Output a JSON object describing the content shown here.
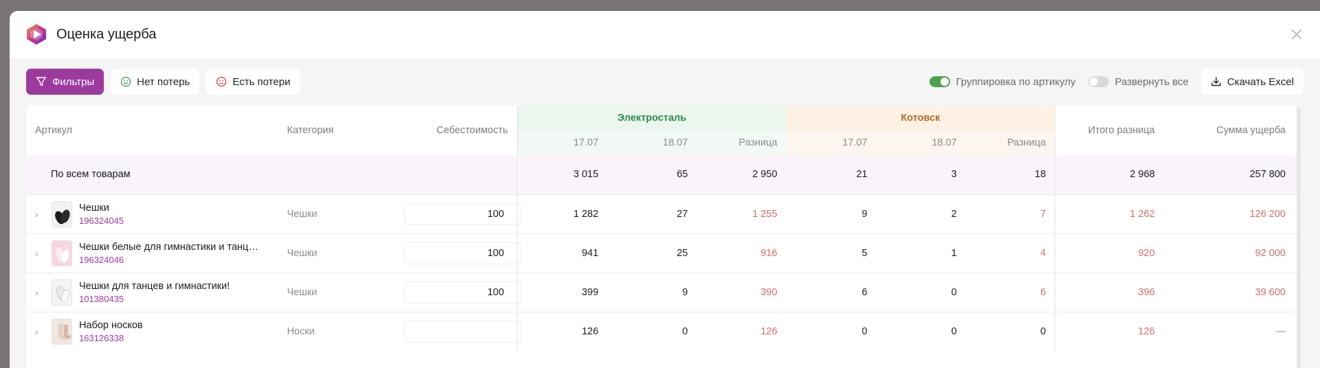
{
  "modal": {
    "title": "Оценка ущерба"
  },
  "toolbar": {
    "filters_label": "Фильтры",
    "no_losses_label": "Нет потерь",
    "has_losses_label": "Есть потери",
    "group_by_article_label": "Группировка по артикулу",
    "group_by_article_on": true,
    "expand_all_label": "Развернуть все",
    "expand_all_on": false,
    "download_excel_label": "Скачать Excel"
  },
  "table": {
    "headers": {
      "article": "Артикул",
      "category": "Категория",
      "cost": "Себестоимость",
      "warehouse_1": "Электросталь",
      "warehouse_2": "Котовск",
      "date_1": "17.07",
      "date_2": "18.07",
      "diff": "Разница",
      "total_diff": "Итого разница",
      "damage_sum": "Сумма ущерба"
    },
    "total_row": {
      "label": "По всем товарам",
      "el_d1": "3 015",
      "el_d2": "65",
      "el_diff": "2 950",
      "kt_d1": "21",
      "kt_d2": "3",
      "kt_diff": "18",
      "total_diff": "2 968",
      "damage": "257 800"
    },
    "rows": [
      {
        "name": "Чешки",
        "sku": "196324045",
        "category": "Чешки",
        "cost": "100",
        "el_d1": "1 282",
        "el_d2": "27",
        "el_diff": "1 255",
        "kt_d1": "9",
        "kt_d2": "2",
        "kt_diff": "7",
        "total_diff": "1 262",
        "damage": "126 200"
      },
      {
        "name": "Чешки белые для гимнастики и танц…",
        "sku": "196324046",
        "category": "Чешки",
        "cost": "100",
        "el_d1": "941",
        "el_d2": "25",
        "el_diff": "916",
        "kt_d1": "5",
        "kt_d2": "1",
        "kt_diff": "4",
        "total_diff": "920",
        "damage": "92 000"
      },
      {
        "name": "Чешки для танцев и гимнастики!",
        "sku": "101380435",
        "category": "Чешки",
        "cost": "100",
        "el_d1": "399",
        "el_d2": "9",
        "el_diff": "390",
        "kt_d1": "6",
        "kt_d2": "0",
        "kt_diff": "6",
        "total_diff": "396",
        "damage": "39 600"
      },
      {
        "name": "Набор носков",
        "sku": "163126338",
        "category": "Носки",
        "cost": "",
        "el_d1": "126",
        "el_d2": "0",
        "el_diff": "126",
        "kt_d1": "0",
        "kt_d2": "0",
        "kt_diff": "0",
        "total_diff": "126",
        "damage": "—"
      }
    ]
  },
  "colors": {
    "accent": "#9c3a9e",
    "loss_red": "#c4433e",
    "toggle_on": "#4ca34f"
  }
}
